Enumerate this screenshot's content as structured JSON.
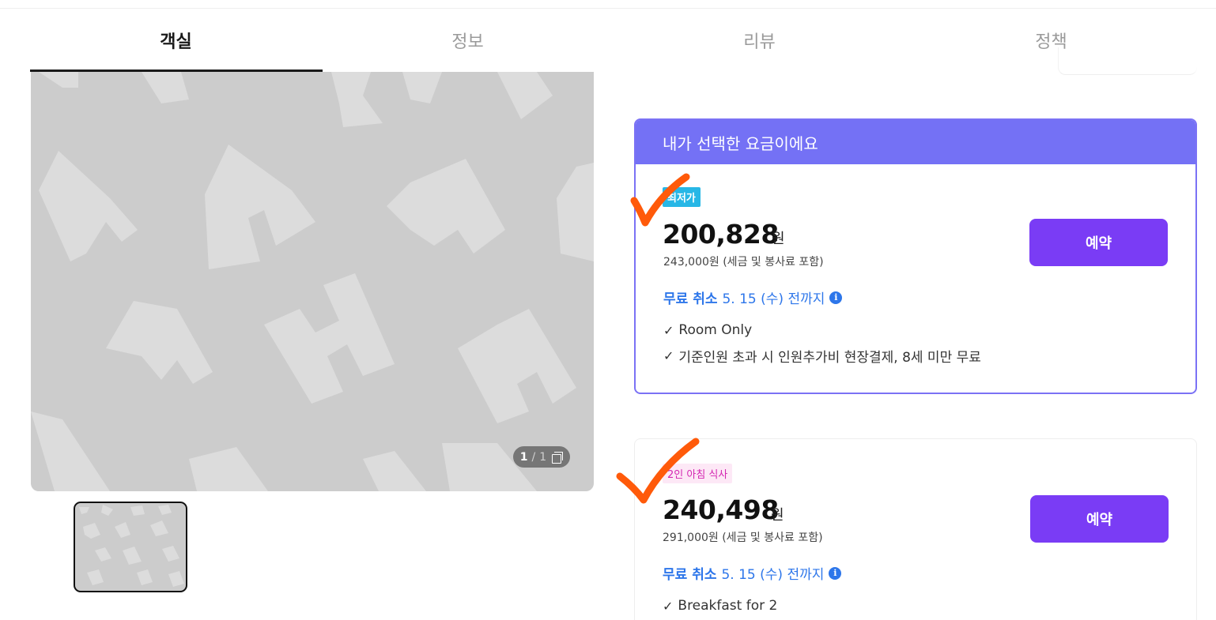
{
  "tabs": [
    {
      "label": "객실",
      "active": true
    },
    {
      "label": "정보",
      "active": false
    },
    {
      "label": "리뷰",
      "active": false
    },
    {
      "label": "정책",
      "active": false
    }
  ],
  "gallery": {
    "current": "1",
    "separator": "/",
    "total": "1",
    "icon": "gallery-icon"
  },
  "selected_banner": "내가 선택한 요금이에요",
  "rates": [
    {
      "badge": "최저가",
      "price": "200,828",
      "currency": "원",
      "original": "243,000원 (세금 및 봉사료 포함)",
      "cancel_label": "무료 취소",
      "cancel_date": "5. 15 (수) 전까지",
      "benefits": [
        "Room Only",
        "기준인원 초과 시 인원추가비 현장결제, 8세 미만 무료"
      ],
      "button": "예약"
    },
    {
      "badge": "2인 아침 식사",
      "price": "240,498",
      "currency": "원",
      "original": "291,000원 (세금 및 봉사료 포함)",
      "cancel_label": "무료 취소",
      "cancel_date": "5. 15 (수) 전까지",
      "benefits": [
        "Breakfast for 2"
      ],
      "button": "예약"
    }
  ],
  "colors": {
    "accent_purple": "#7a3cf5",
    "banner": "#7471f5",
    "link_blue": "#2d76ea",
    "lowest_badge": "#27b7e6",
    "breakfast_badge_text": "#d427b2",
    "annotation_check": "#ff5a0a"
  },
  "icons": {
    "info": "info-icon",
    "check": "check-icon",
    "info_glyph": "i",
    "check_glyph": "✓"
  }
}
